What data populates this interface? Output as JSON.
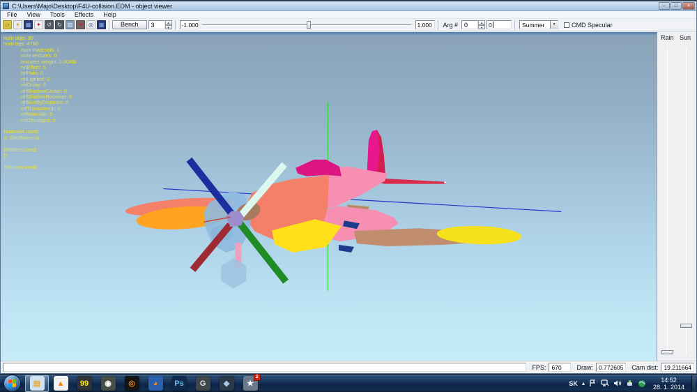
{
  "window": {
    "title": "C:\\Users\\Majo\\Desktop\\F4U-collision.EDM - object viewer",
    "minimize_glyph": "–",
    "maximize_glyph": "□",
    "close_glyph": "×"
  },
  "ui": {
    "spin_up": "▲",
    "spin_down": "▼",
    "dropdown_arrow": "▼",
    "tray_expand": "▴"
  },
  "menu": {
    "items": [
      "File",
      "View",
      "Tools",
      "Effects",
      "Help"
    ]
  },
  "toolbar": {
    "icons": [
      {
        "name": "open-folder-icon",
        "glyph": "▱",
        "bg": "#d9c545",
        "fg": "#5e4a10"
      },
      {
        "name": "new-folder-icon",
        "glyph": "✶",
        "bg": "#e9ebf1",
        "fg": "#c8a300"
      },
      {
        "name": "import-model-icon",
        "glyph": "▦",
        "bg": "#2a3a78",
        "fg": "#8cb8e8"
      },
      {
        "name": "run-benchmark-icon",
        "glyph": "✦",
        "bg": "#f0f0f0",
        "fg": "#c41c1c"
      },
      {
        "name": "camera-back-icon",
        "glyph": "↺",
        "bg": "#50575f",
        "fg": "#e4e6ea"
      },
      {
        "name": "camera-forward-icon",
        "glyph": "↻",
        "bg": "#50575f",
        "fg": "#e4e6ea"
      },
      {
        "name": "view-mode-icon",
        "glyph": "▥",
        "bg": "#8198b6",
        "fg": "#e0ecf8"
      },
      {
        "name": "run-animation-icon",
        "glyph": "✦",
        "bg": "#776060",
        "fg": "#d42020"
      },
      {
        "name": "search-icon",
        "glyph": "◎",
        "bg": "#e9ebf1",
        "fg": "#2f4a8c"
      },
      {
        "name": "info-icon",
        "glyph": "▦",
        "bg": "#2a3a78",
        "fg": "#84b0e0"
      }
    ],
    "bench_label": "Bench",
    "bench_value": "3",
    "range_min": "-1.000",
    "range_value": "1.000",
    "arg_label": "Arg #",
    "arg_value": "0",
    "arg_input": "0",
    "season_selected": "Summer",
    "specular_label": "CMD Specular",
    "specular_checked": false
  },
  "viewport": {
    "stats": [
      "num objs: 30",
      "num trgs: 4790",
      "            num materials: 1",
      "            num textures: 0",
      "            textures weight: 0.00Mb",
      "            mfEffect: 0",
      "            mfHalo: 0",
      "            mfLighted: 0",
      "            mfOnlay: 0",
      "            mfShadowCaster: 0",
      "            mfShadowReceiver: 0",
      "            mfSortByDistance: 0",
      "            mfTransparent: 0",
      "            mfWarmAir: 0",
      "            mfIZNudged: 0",
      "",
      "Materials used:",
      "0: ShellMaterial",
      "",
      "Shaders used:",
      "0:",
      "",
      "Textures used:"
    ],
    "colors": {
      "sky_top": "#4f7cb0",
      "sky_high": "#8aa3b9",
      "sky_low": "#c6ecf9",
      "stats_text": "#e8e23c"
    }
  },
  "plane": {
    "colors": {
      "fuselage": "#F4806A",
      "rear_fuselage": "#F78FB3",
      "canopy": "#DD1583",
      "fin_front": "#E8188C",
      "fin_rear": "#D12050",
      "stabilizer": "#D92D4E",
      "wing_orange": "#FFA321",
      "wing_salmon": "#F4806A",
      "wing_tan": "#C08E6E",
      "wing_yellow": "#F7E11C",
      "wing_root_yellow": "#FFE01A",
      "navy_detail": "#1B3C8C",
      "cowl_blue": "#8FB9DF",
      "spinner": "#A87B5E",
      "hub": "#9D8CCB",
      "blade_navy": "#1B2F9E",
      "blade_cyan": "#DCF7F0",
      "blade_maroon": "#9E2B33",
      "blade_green": "#1F8C25",
      "gear_strut": "#F2A0BE",
      "wheel": "#9DC2E2",
      "teal_shadow": "#69A0B5",
      "tail_wheel": "#B98A62",
      "axis_green": "#2FCC40",
      "axis_blue": "#2236C8",
      "axis_red": "#D03018",
      "pitot_tip": "#FFFFFF"
    }
  },
  "side_panel": {
    "rain_label": "Rain",
    "sun_label": "Sun"
  },
  "status_bar": {
    "fps_label": "FPS:",
    "fps": "670",
    "draw_label": "Draw:",
    "draw": "0.772605",
    "cam_label": "Cam dist:",
    "cam": "19.211664"
  },
  "taskbar": {
    "apps": [
      {
        "name": "taskbar-explorer-button",
        "glyph": "▤",
        "bg": "#cfe3f5",
        "fg": "#e8a830",
        "cls": "active"
      },
      {
        "name": "taskbar-vlc-button",
        "glyph": "▲",
        "bg": "#f2f2f2",
        "fg": "#ff7d00"
      },
      {
        "name": "taskbar-perfmonitor-button",
        "glyph": "99",
        "bg": "#2e3338",
        "fg": "#ffe600"
      },
      {
        "name": "taskbar-panda-button",
        "glyph": "◉",
        "bg": "#454d45",
        "fg": "#ffffff"
      },
      {
        "name": "taskbar-emblem-button",
        "glyph": "◎",
        "bg": "#141414",
        "fg": "#e87c1e"
      },
      {
        "name": "taskbar-firefox-button",
        "glyph": "◕",
        "bg": "#2b5fae",
        "fg": "#ff8a00"
      },
      {
        "name": "taskbar-photoshop-button",
        "glyph": "Ps",
        "bg": "#0d2a4a",
        "fg": "#6cb8f0"
      },
      {
        "name": "taskbar-gom-button",
        "glyph": "G",
        "bg": "#40454c",
        "fg": "#e0e4e8"
      },
      {
        "name": "taskbar-usb-guard-button",
        "glyph": "◆",
        "bg": "#2a3a4a",
        "fg": "#a8c8e8"
      },
      {
        "name": "taskbar-lockon-button",
        "glyph": "★",
        "bg": "#6a7a8c",
        "fg": "#ffffff",
        "badge": "2"
      }
    ],
    "tray": {
      "lang": "SK",
      "time": "14:52",
      "date": "28. 1. 2014"
    }
  }
}
